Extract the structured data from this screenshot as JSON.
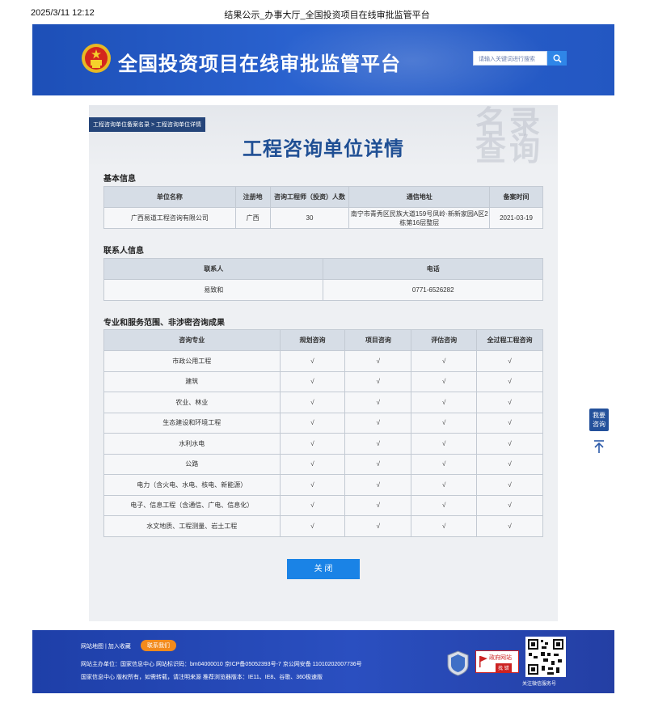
{
  "print_header": {
    "datetime": "2025/3/11 12:12",
    "page_title": "结果公示_办事大厅_全国投资项目在线审批监管平台"
  },
  "header": {
    "site_title": "全国投资项目在线审批监管平台",
    "search_placeholder": "请输入关键词进行搜索"
  },
  "breadcrumb": "工程咨询单位备案名录 > 工程咨询单位详情",
  "watermark": {
    "line1": "名录",
    "line2": "查询"
  },
  "page_title": "工程咨询单位详情",
  "basic_info": {
    "section_title": "基本信息",
    "headers": [
      "单位名称",
      "注册地",
      "咨询工程师（投资）人数",
      "通信地址",
      "备案时间"
    ],
    "row": [
      "广西易道工程咨询有限公司",
      "广西",
      "30",
      "南宁市青秀区民族大道159号凤岭·新新家园A区2栋第16层整层",
      "2021-03-19"
    ]
  },
  "contact_info": {
    "section_title": "联系人信息",
    "headers": [
      "联系人",
      "电话"
    ],
    "row": [
      "易致和",
      "0771-6526282"
    ]
  },
  "scope": {
    "section_title": "专业和服务范围、非涉密咨询成果",
    "headers": [
      "咨询专业",
      "规划咨询",
      "项目咨询",
      "评估咨询",
      "全过程工程咨询"
    ],
    "rows": [
      [
        "市政公用工程",
        "√",
        "√",
        "√",
        "√"
      ],
      [
        "建筑",
        "√",
        "√",
        "√",
        "√"
      ],
      [
        "农业、林业",
        "√",
        "√",
        "√",
        "√"
      ],
      [
        "生态建设和环境工程",
        "√",
        "√",
        "√",
        "√"
      ],
      [
        "水利水电",
        "√",
        "√",
        "√",
        "√"
      ],
      [
        "公路",
        "√",
        "√",
        "√",
        "√"
      ],
      [
        "电力（含火电、水电、核电、新能源）",
        "√",
        "√",
        "√",
        "√"
      ],
      [
        "电子、信息工程（含通信、广电、信息化）",
        "√",
        "√",
        "√",
        "√"
      ],
      [
        "水文地质、工程测量、岩土工程",
        "√",
        "√",
        "√",
        "√"
      ]
    ]
  },
  "close_label": "关 闭",
  "side": {
    "consult": "我要咨询"
  },
  "footer": {
    "links": "网站地图 | 加入收藏",
    "contact_label": "联系我们",
    "line1": "网站主办单位：国家信息中心   网站标识码：bm04000010   京ICP备05052393号-7   京公网安备 11010202007736号",
    "line2": "国家信息中心 版权所有，如需转载，请注明来源   推荐浏览器版本：IE11、IE8、谷歌、360极速版",
    "badge_title": "政府网站",
    "badge_sub": "找 错",
    "qr_caption": "关注微信服务号"
  },
  "colors": {
    "banner": "#2357c2",
    "title": "#1f4f94",
    "button": "#1a83e6",
    "footer": "#2a4fc0",
    "orange": "#f28a1c"
  }
}
